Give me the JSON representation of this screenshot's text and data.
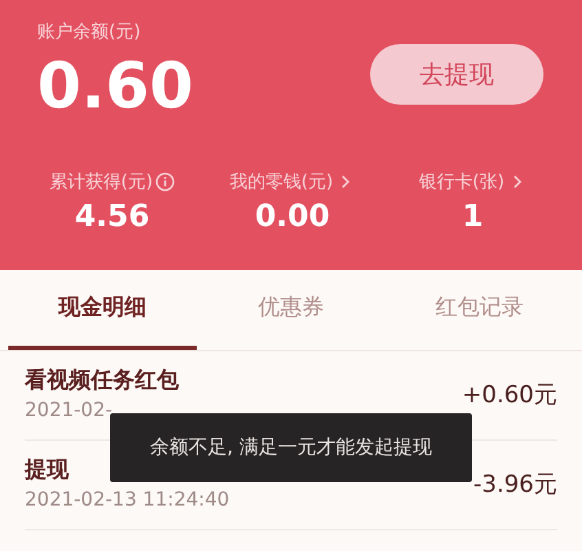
{
  "balance": {
    "label": "账户余额(元)",
    "amount": "0.60",
    "button": "去提现"
  },
  "stats": [
    {
      "label": "累计获得(元)",
      "value": "4.56",
      "kind": "info"
    },
    {
      "label": "我的零钱(元)",
      "value": "0.00",
      "kind": "link"
    },
    {
      "label": "银行卡(张)",
      "value": "1",
      "kind": "link"
    }
  ],
  "tabs": [
    {
      "label": "现金明细",
      "selected": true
    },
    {
      "label": "优惠券",
      "selected": false
    },
    {
      "label": "红包记录",
      "selected": false
    }
  ],
  "records": [
    {
      "title": "看视频任务红包",
      "time": "2021-02-",
      "amount": "+0.60元"
    },
    {
      "title": "提现",
      "time": "2021-02-13 11:24:40",
      "amount": "-3.96元"
    }
  ],
  "toast": "余额不足, 满足一元才能发起提现"
}
